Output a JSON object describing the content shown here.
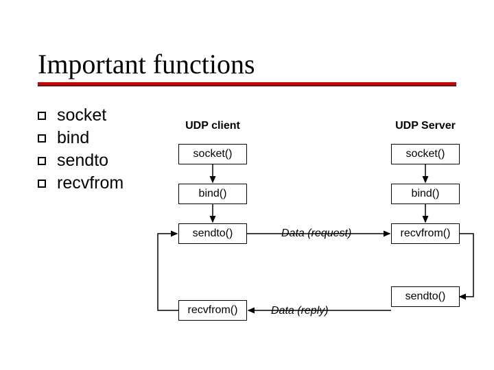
{
  "title": "Important functions",
  "bullets": [
    "socket",
    "bind",
    "sendto",
    "recvfrom"
  ],
  "diagram": {
    "client_header": "UDP client",
    "server_header": "UDP Server",
    "client_boxes": [
      "socket()",
      "bind()",
      "sendto()",
      "recvfrom()"
    ],
    "server_boxes": [
      "socket()",
      "bind()",
      "recvfrom()",
      "sendto()"
    ],
    "middle_labels": [
      "Data (request)",
      "Data (reply)"
    ]
  }
}
